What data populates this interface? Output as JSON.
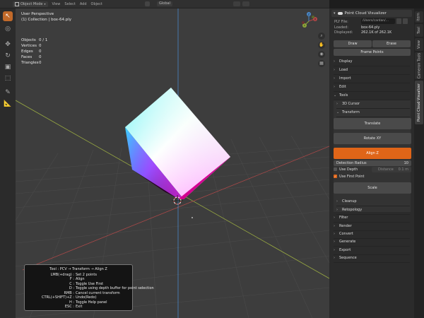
{
  "header": {
    "mode": "Object Mode",
    "menus": [
      "View",
      "Select",
      "Add",
      "Object"
    ],
    "transform_orientation": "Global"
  },
  "viewport": {
    "view_name": "User Perspective",
    "collection": "(1) Collection | box-64.ply",
    "stats": [
      {
        "label": "Objects",
        "value": "0 / 1"
      },
      {
        "label": "Vertices",
        "value": "0"
      },
      {
        "label": "Edges",
        "value": "0"
      },
      {
        "label": "Faces",
        "value": "0"
      },
      {
        "label": "Triangles",
        "value": "0"
      }
    ],
    "gizmo": {
      "x": "X",
      "y": "Y",
      "z": "Z"
    }
  },
  "help": {
    "title": "Tool : PCV → Transform → Align Z",
    "lines": [
      {
        "key": "LMB(+drag) :",
        "desc": "Set 2 points"
      },
      {
        "key": "F :",
        "desc": "Align"
      },
      {
        "key": "C :",
        "desc": "Toggle Use First"
      },
      {
        "key": "D :",
        "desc": "Toggle using depth buffer for point selection"
      },
      {
        "key": "RMB :",
        "desc": "Cancel current transform"
      },
      {
        "key": "CTRL(+SHIFT)+Z :",
        "desc": "Undo(Redo)"
      },
      {
        "key": "H :",
        "desc": "Toggle Help panel"
      },
      {
        "key": "ESC :",
        "desc": "Exit"
      }
    ]
  },
  "sidebar": {
    "tabs": [
      "Item",
      "Tool",
      "View",
      "Cameron Tools",
      "Point Cloud Visualizer"
    ],
    "panel_title": "Point Cloud Visualizer",
    "ply_file_label": "PLY File:",
    "ply_file_value": "/Users/cardan/...",
    "loaded_label": "Loaded:",
    "loaded_value": "box-64.ply",
    "displayed_label": "Displayed:",
    "displayed_value": "262.1K of 262.1K",
    "draw_label": "Draw",
    "erase_label": "Erase",
    "frame_points_label": "Frame Points",
    "sections_top": [
      "Display",
      "Load",
      "Import",
      "Edit",
      "Tools"
    ],
    "tools_sub": [
      "3D Cursor",
      "Transform"
    ],
    "translate_label": "Translate",
    "rotate_label": "Rotate XY",
    "align_label": "Align Z",
    "detection_radius_label": "Detection Radius",
    "detection_radius_value": "10",
    "use_depth_label": "Use Depth",
    "distance_label": "Distance",
    "distance_value": "0.1 m",
    "use_first_point_label": "Use First Point",
    "scale_label": "Scale",
    "tools_sub2": [
      "Cleanup",
      "Retopology"
    ],
    "sections_bottom": [
      "Filter",
      "Render",
      "Convert",
      "Generate",
      "Export",
      "Sequence"
    ]
  },
  "colors": {
    "accent": "#e06518",
    "viewport_bg": "#3d3d3d",
    "panel_bg": "#2b2b2b",
    "axis_x": "#b54848",
    "axis_y": "#8fa83a",
    "axis_z": "#4a88c8"
  }
}
